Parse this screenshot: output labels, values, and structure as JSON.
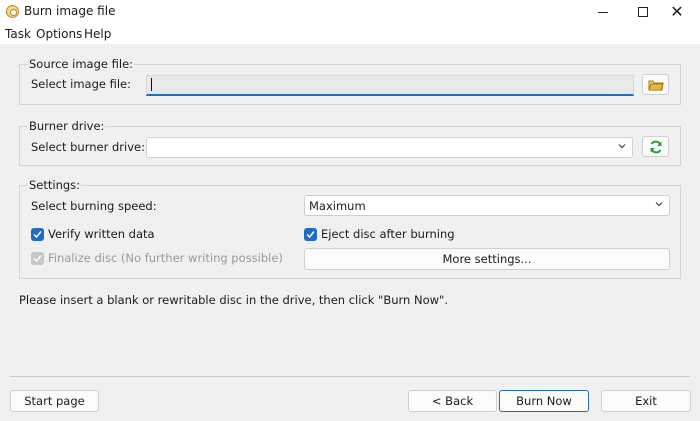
{
  "window": {
    "title": "Burn image file",
    "controls": {
      "minimize_icon": "minimize-icon",
      "maximize_icon": "maximize-icon",
      "close_icon": "close-icon"
    }
  },
  "menu": [
    "Task",
    "Options",
    "Help"
  ],
  "source": {
    "group_title": "Source image file:",
    "label": "Select image file:",
    "value": "",
    "browse_icon": "folder-icon"
  },
  "burner": {
    "group_title": "Burner drive:",
    "label": "Select burner drive:",
    "value": "",
    "refresh_icon": "refresh-icon"
  },
  "settings": {
    "group_title": "Settings:",
    "speed_label": "Select burning speed:",
    "speed_value": "Maximum",
    "verify_label": "Verify written data",
    "verify_checked": true,
    "eject_label": "Eject disc after burning",
    "eject_checked": true,
    "finalize_label": "Finalize disc (No further writing possible)",
    "finalize_checked": true,
    "finalize_enabled": false,
    "more_settings_label": "More settings..."
  },
  "status_text": "Please insert a blank or rewritable disc in the drive, then click \"Burn Now\".",
  "footer": {
    "start_page_label": "Start page",
    "back_label": "< Back",
    "burn_now_label": "Burn Now",
    "exit_label": "Exit"
  },
  "colors": {
    "accent": "#1f6bc5",
    "background": "#f0f0f0",
    "refresh_green": "#2e9e3a",
    "folder_yellow": "#e8b93a"
  }
}
